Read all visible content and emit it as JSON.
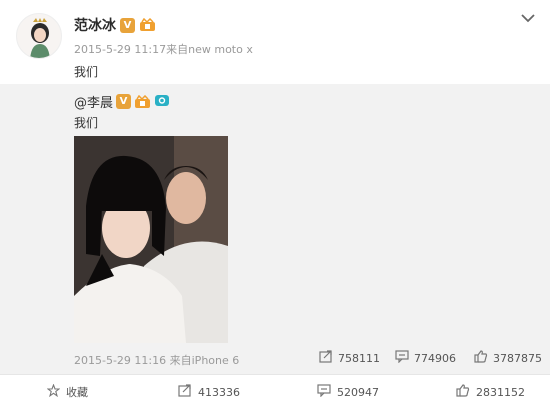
{
  "post": {
    "author": "范冰冰",
    "timestamp": "2015-5-29 11:17",
    "source": "来自new moto x",
    "text": "我们"
  },
  "repost": {
    "author": "@李晨",
    "text": "我们",
    "timestamp": "2015-5-29 11:16",
    "source": "来自iPhone 6",
    "reposts": "758111",
    "comments": "774906",
    "likes": "3787875"
  },
  "actions": {
    "favorite_label": "收藏",
    "reposts": "413336",
    "comments": "520947",
    "likes": "2831152"
  },
  "colors": {
    "badge": "#e8a33a",
    "repost_bg": "#f2f2f2",
    "meta": "#9a9a9a"
  }
}
